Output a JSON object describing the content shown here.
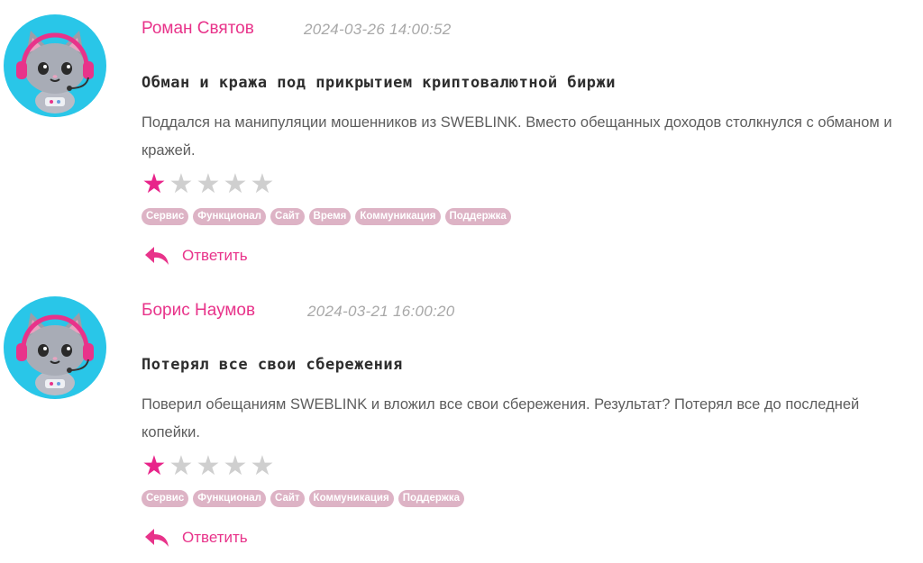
{
  "colors": {
    "accent": "#e8338a",
    "star_on": "#e8248a",
    "star_off": "#cfcfcf",
    "tag_bg": "#ddb3c5",
    "avatar_bg": "#29c6e8"
  },
  "icons": {
    "avatar": "cat-gamer-avatar",
    "reply": "reply-arrow-icon",
    "star": "star-icon"
  },
  "reviews": [
    {
      "author": "Роман Святов",
      "date": "2024-03-26 14:00:52",
      "title": "Обман и кража под прикрытием криптовалютной биржи",
      "body": "Поддался на манипуляции мошенников из SWEBLINK. Вместо обещанных доходов столкнулся с обманом и кражей.",
      "rating": 1,
      "rating_max": 5,
      "tags": [
        "Сервис",
        "Функционал",
        "Сайт",
        "Время",
        "Коммуникация",
        "Поддержка"
      ],
      "reply_label": "Ответить"
    },
    {
      "author": "Борис Наумов",
      "date": "2024-03-21 16:00:20",
      "title": "Потерял все свои сбережения",
      "body": "Поверил обещаниям SWEBLINK и вложил все свои сбережения. Результат? Потерял все до последней копейки.",
      "rating": 1,
      "rating_max": 5,
      "tags": [
        "Сервис",
        "Функционал",
        "Сайт",
        "Коммуникация",
        "Поддержка"
      ],
      "reply_label": "Ответить"
    }
  ]
}
